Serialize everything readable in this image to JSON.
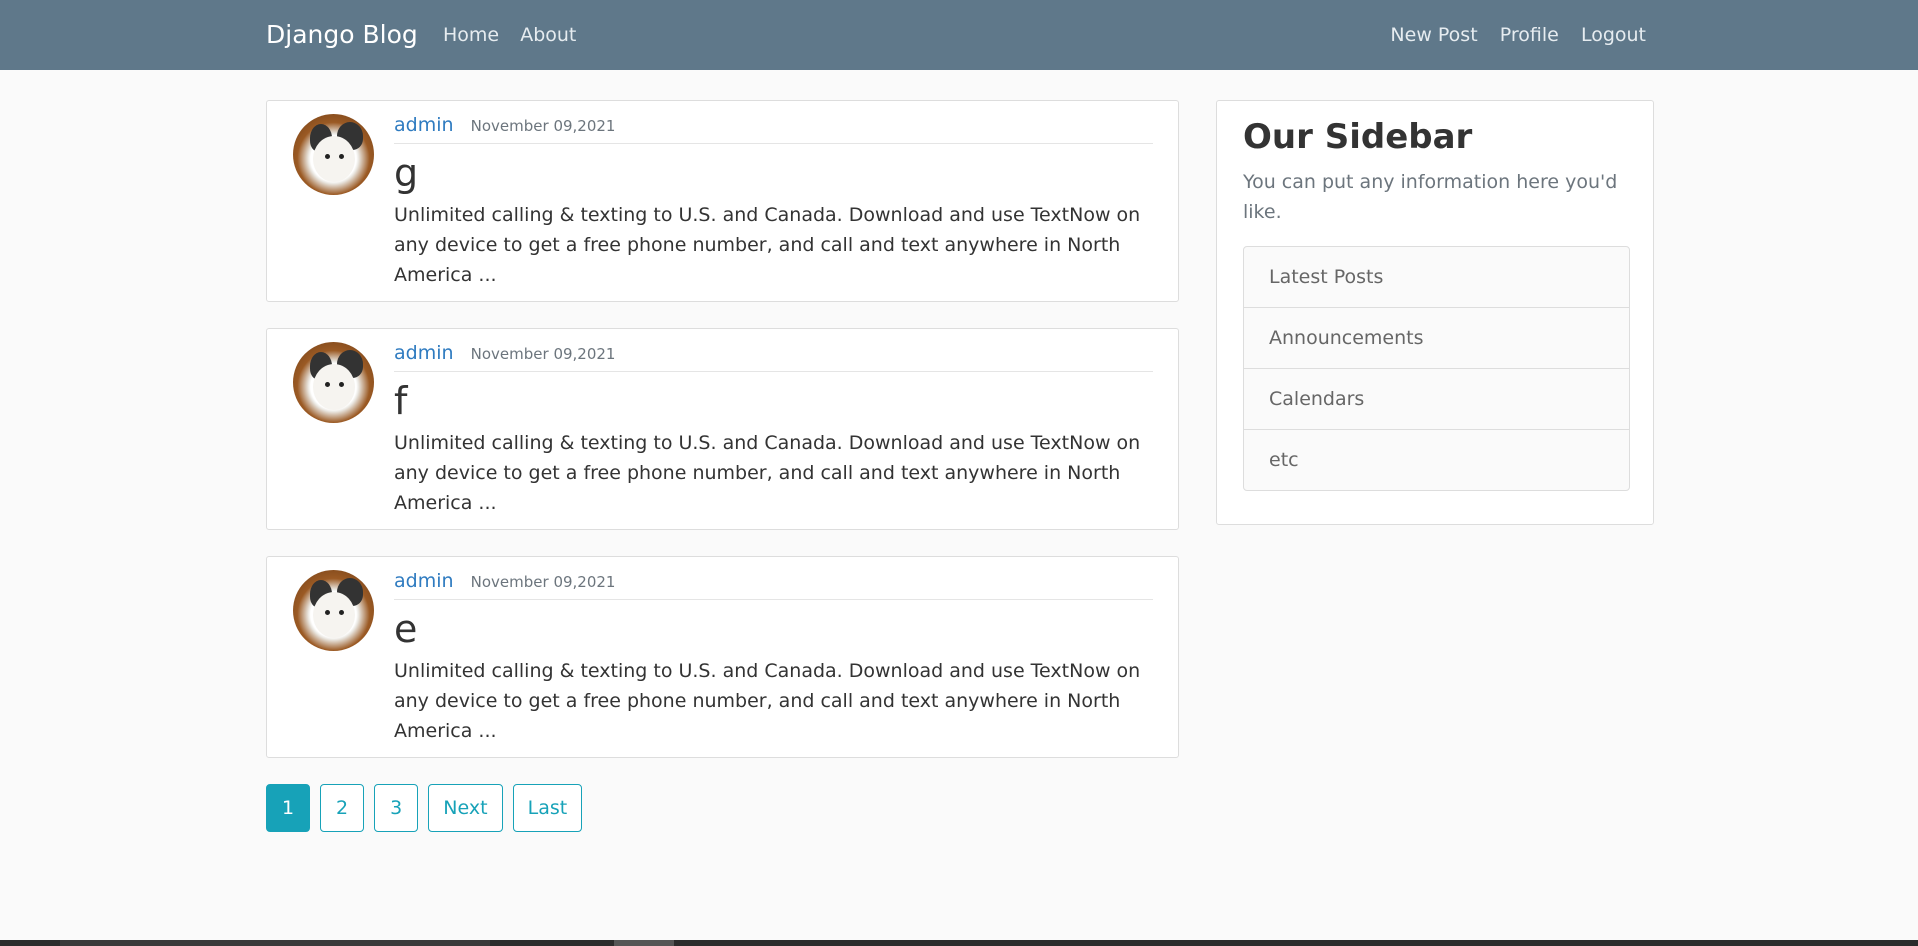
{
  "nav": {
    "brand": "Django Blog",
    "left": [
      "Home",
      "About"
    ],
    "right": [
      "New Post",
      "Profile",
      "Logout"
    ]
  },
  "posts": [
    {
      "author": "admin",
      "date": "November 09,2021",
      "title": "g",
      "content": "Unlimited calling & texting to U.S. and Canada. Download and use TextNow on any device to get a free phone number, and call and text anywhere in North America ..."
    },
    {
      "author": "admin",
      "date": "November 09,2021",
      "title": "f",
      "content": "Unlimited calling & texting to U.S. and Canada. Download and use TextNow on any device to get a free phone number, and call and text anywhere in North America ..."
    },
    {
      "author": "admin",
      "date": "November 09,2021",
      "title": "e",
      "content": "Unlimited calling & texting to U.S. and Canada. Download and use TextNow on any device to get a free phone number, and call and text anywhere in North America ..."
    }
  ],
  "pagination": [
    "1",
    "2",
    "3",
    "Next",
    "Last"
  ],
  "pagination_active": "1",
  "sidebar": {
    "title": "Our Sidebar",
    "description": "You can put any information here you'd like.",
    "items": [
      "Latest Posts",
      "Announcements",
      "Calendars",
      "etc"
    ]
  },
  "colors": {
    "navbar": "#5f788a",
    "link": "#2f7bc0",
    "accent": "#17a2b8"
  }
}
